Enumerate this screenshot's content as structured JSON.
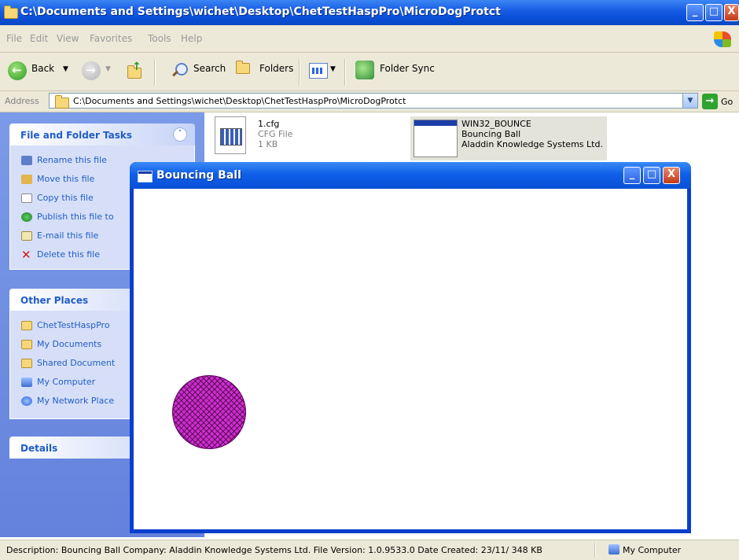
{
  "explorer": {
    "title": "C:\\Documents and Settings\\wichet\\Desktop\\ChetTestHaspPro\\MicroDogProtct",
    "window_buttons": {
      "minimize": "_",
      "maximize": "□",
      "close": "X"
    }
  },
  "menu": [
    "File",
    "Edit",
    "View",
    "Favorites",
    "Tools",
    "Help"
  ],
  "toolbar": {
    "back": "Back",
    "search": "Search",
    "folders": "Folders",
    "folder_sync": "Folder Sync"
  },
  "address": {
    "label": "Address",
    "value": "C:\\Documents and Settings\\wichet\\Desktop\\ChetTestHaspPro\\MicroDogProtct",
    "go": "Go"
  },
  "task_pane": {
    "file_tasks": {
      "title": "File and Folder Tasks",
      "items": [
        "Rename this file",
        "Move this file",
        "Copy this file",
        "Publish this file to",
        "E-mail this file",
        "Delete this file"
      ]
    },
    "other_places": {
      "title": "Other Places",
      "items": [
        "ChetTestHaspPro",
        "My Documents",
        "Shared Document",
        "My Computer",
        "My Network Place"
      ]
    },
    "details": {
      "title": "Details"
    }
  },
  "files": [
    {
      "name": "1.cfg",
      "type": "CFG File",
      "size": "1 KB"
    },
    {
      "name": "WIN32_BOUNCE",
      "type": "Bouncing Ball",
      "company": "Aladdin Knowledge Systems Ltd."
    }
  ],
  "bouncing_window": {
    "title": "Bouncing Ball",
    "ball_color": "#cc2ecc"
  },
  "status": {
    "description": "Description: Bouncing Ball Company: Aladdin Knowledge Systems Ltd. File Version: 1.0.9533.0 Date Created: 23/11/ 348 KB",
    "zone": "My Computer"
  },
  "colors": {
    "xp_blue": "#0a4fd8",
    "task_pane": "#7b9be8",
    "link": "#215dc6"
  }
}
